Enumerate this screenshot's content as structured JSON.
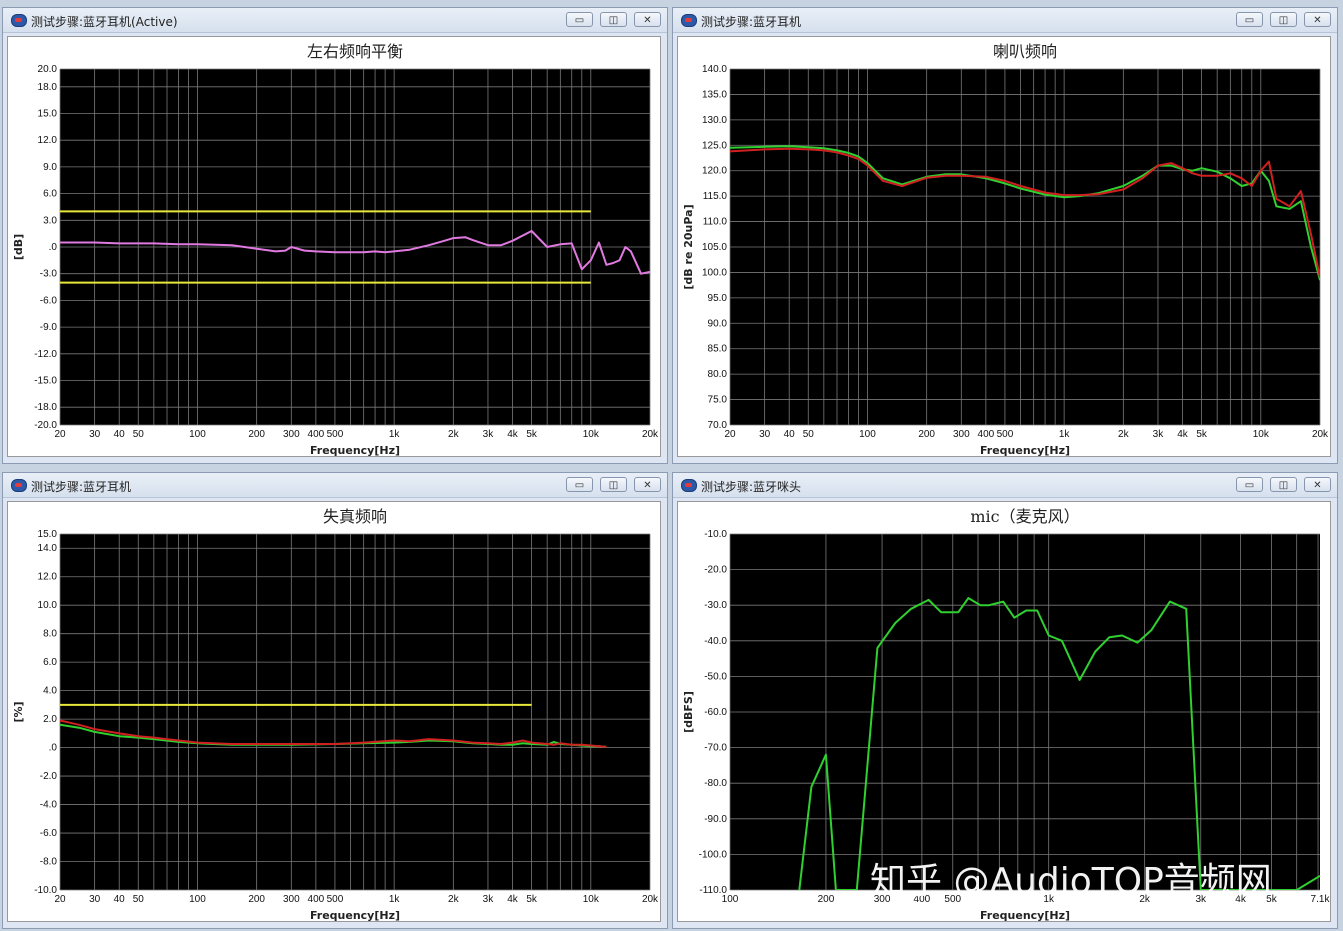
{
  "colors": {
    "plot_bg": "#000000",
    "grid": "#7a7a7a",
    "limit": "#e8e83a",
    "pink": "#e07ae0",
    "green": "#30d030",
    "red": "#d02020"
  },
  "windows": [
    {
      "title": "测试步骤:蓝牙耳机(Active)",
      "buttons": [
        "▭",
        "◫",
        "✕"
      ]
    },
    {
      "title": "测试步骤:蓝牙耳机",
      "buttons": [
        "▭",
        "◫",
        "✕"
      ]
    },
    {
      "title": "测试步骤:蓝牙耳机",
      "buttons": [
        "▭",
        "◫",
        "✕"
      ]
    },
    {
      "title": "测试步骤:蓝牙咪头",
      "buttons": [
        "▭",
        "◫",
        "✕"
      ]
    }
  ],
  "watermark": "知乎 @AudioTOP音频网",
  "chart_data": [
    {
      "type": "line",
      "title": "左右频响平衡",
      "xlabel": "Frequency[Hz]",
      "ylabel": "[dB]",
      "xscale": "log",
      "xlim": [
        20,
        20000
      ],
      "ylim": [
        -20,
        20
      ],
      "yticks": [
        20,
        18,
        15,
        12,
        9,
        6,
        3,
        0,
        -3,
        -6,
        -9,
        -12,
        -15,
        -18,
        -20
      ],
      "ytick_labels": [
        "20.0",
        "18.0",
        "15.0",
        "12.0",
        "9.0",
        "6.0",
        "3.0",
        ".0",
        "-3.0",
        "-6.0",
        "-9.0",
        "-12.0",
        "-15.0",
        "-18.0",
        "-20.0"
      ],
      "xticks": [
        20,
        30,
        40,
        50,
        100,
        200,
        300,
        400,
        500,
        1000,
        2000,
        3000,
        4000,
        5000,
        10000,
        20000
      ],
      "xtick_labels": [
        "20",
        "30",
        "40",
        "50",
        "100",
        "200",
        "300",
        "400",
        "500",
        "1k",
        "2k",
        "3k",
        "4k",
        "5k",
        "10k",
        "20k"
      ],
      "grid": true,
      "series": [
        {
          "color": "#e8e83a",
          "x": [
            20,
            10000
          ],
          "y": [
            4,
            4
          ]
        },
        {
          "color": "#e8e83a",
          "x": [
            20,
            10000
          ],
          "y": [
            -4,
            -4
          ]
        },
        {
          "color": "#e07ae0",
          "x": [
            20,
            30,
            40,
            60,
            80,
            100,
            150,
            200,
            250,
            280,
            300,
            350,
            400,
            500,
            600,
            700,
            800,
            900,
            1000,
            1200,
            1500,
            1800,
            2000,
            2300,
            2500,
            3000,
            3500,
            4000,
            5000,
            6000,
            7000,
            8000,
            9000,
            10000,
            11000,
            12000,
            13000,
            14000,
            15000,
            16000,
            18000,
            20000
          ],
          "y": [
            0.5,
            0.5,
            0.4,
            0.4,
            0.3,
            0.3,
            0.2,
            -0.2,
            -0.5,
            -0.4,
            0.0,
            -0.4,
            -0.5,
            -0.6,
            -0.6,
            -0.6,
            -0.5,
            -0.6,
            -0.5,
            -0.3,
            0.2,
            0.7,
            1.0,
            1.1,
            0.8,
            0.2,
            0.2,
            0.7,
            1.8,
            0.0,
            0.3,
            0.4,
            -2.5,
            -1.5,
            0.5,
            -2.0,
            -1.8,
            -1.5,
            0.0,
            -0.5,
            -3.0,
            -2.8
          ]
        }
      ]
    },
    {
      "type": "line",
      "title": "喇叭频响",
      "xlabel": "Frequency[Hz]",
      "ylabel": "[dB re 20uPa]",
      "xscale": "log",
      "xlim": [
        20,
        20000
      ],
      "ylim": [
        70,
        140
      ],
      "yticks": [
        140,
        135,
        130,
        125,
        120,
        115,
        110,
        105,
        100,
        95,
        90,
        85,
        80,
        75,
        70
      ],
      "ytick_labels": [
        "140.0",
        "135.0",
        "130.0",
        "125.0",
        "120.0",
        "115.0",
        "110.0",
        "105.0",
        "100.0",
        "95.0",
        "90.0",
        "85.0",
        "80.0",
        "75.0",
        "70.0"
      ],
      "xticks": [
        20,
        30,
        40,
        50,
        100,
        200,
        300,
        400,
        500,
        1000,
        2000,
        3000,
        4000,
        5000,
        10000,
        20000
      ],
      "xtick_labels": [
        "20",
        "30",
        "40",
        "50",
        "100",
        "200",
        "300",
        "400",
        "500",
        "1k",
        "2k",
        "3k",
        "4k",
        "5k",
        "10k",
        "20k"
      ],
      "grid": true,
      "series": [
        {
          "name": "",
          "color": "#30d030",
          "x": [
            20,
            30,
            40,
            50,
            60,
            70,
            80,
            90,
            100,
            120,
            150,
            200,
            250,
            300,
            400,
            500,
            600,
            800,
            1000,
            1200,
            1500,
            2000,
            2500,
            3000,
            3500,
            4000,
            4500,
            5000,
            6000,
            7000,
            8000,
            9000,
            10000,
            11000,
            12000,
            14000,
            16000,
            18000,
            20000
          ],
          "y": [
            124.5,
            124.7,
            124.8,
            124.6,
            124.4,
            124.0,
            123.5,
            122.8,
            121.5,
            118.5,
            117.3,
            118.8,
            119.3,
            119.3,
            118.5,
            117.5,
            116.5,
            115.3,
            114.8,
            115.0,
            115.6,
            117.0,
            119.0,
            121.0,
            121.0,
            120.3,
            120.0,
            120.5,
            119.8,
            118.5,
            117.0,
            117.5,
            120.0,
            118.0,
            113.0,
            112.5,
            114.0,
            105.0,
            98.5
          ]
        },
        {
          "name": "",
          "color": "#d02020",
          "x": [
            20,
            30,
            40,
            50,
            60,
            70,
            80,
            90,
            100,
            120,
            150,
            200,
            250,
            300,
            400,
            500,
            600,
            800,
            1000,
            1200,
            1500,
            2000,
            2500,
            3000,
            3500,
            4000,
            4500,
            5000,
            6000,
            7000,
            8000,
            9000,
            10000,
            11000,
            12000,
            14000,
            16000,
            18000,
            20000
          ],
          "y": [
            123.8,
            124.2,
            124.3,
            124.2,
            124.0,
            123.6,
            123.0,
            122.3,
            121.0,
            118.0,
            117.0,
            118.6,
            119.0,
            119.0,
            118.8,
            118.0,
            117.0,
            115.7,
            115.2,
            115.2,
            115.4,
            116.3,
            118.5,
            121.0,
            121.5,
            120.5,
            119.5,
            119.0,
            119.0,
            119.5,
            118.5,
            117.0,
            120.0,
            121.8,
            114.5,
            113.0,
            116.0,
            107.5,
            99.0
          ]
        }
      ]
    },
    {
      "type": "line",
      "title": "失真频响",
      "xlabel": "Frequency[Hz]",
      "ylabel": "[%]",
      "xscale": "log",
      "xlim": [
        20,
        20000
      ],
      "ylim": [
        -10,
        15
      ],
      "yticks": [
        15,
        14,
        12,
        10,
        8,
        6,
        4,
        2,
        0,
        -2,
        -4,
        -6,
        -8,
        -10
      ],
      "ytick_labels": [
        "15.0",
        "14.0",
        "12.0",
        "10.0",
        "8.0",
        "6.0",
        "4.0",
        "2.0",
        ".0",
        "-2.0",
        "-4.0",
        "-6.0",
        "-8.0",
        "-10.0"
      ],
      "xticks": [
        20,
        30,
        40,
        50,
        100,
        200,
        300,
        400,
        500,
        1000,
        2000,
        3000,
        4000,
        5000,
        10000,
        20000
      ],
      "xtick_labels": [
        "20",
        "30",
        "40",
        "50",
        "100",
        "200",
        "300",
        "400",
        "500",
        "1k",
        "2k",
        "3k",
        "4k",
        "5k",
        "10k",
        "20k"
      ],
      "grid": true,
      "series": [
        {
          "color": "#e8e83a",
          "x": [
            20,
            5000
          ],
          "y": [
            3,
            3
          ]
        },
        {
          "name": "",
          "color": "#30d030",
          "x": [
            20,
            25,
            30,
            40,
            50,
            60,
            80,
            100,
            120,
            150,
            200,
            300,
            500,
            700,
            1000,
            1200,
            1500,
            2000,
            2500,
            3000,
            3500,
            4000,
            4500,
            5000,
            6000,
            6500,
            7000,
            8000,
            9000,
            10000,
            11000,
            12000
          ],
          "y": [
            1.6,
            1.4,
            1.1,
            0.8,
            0.7,
            0.6,
            0.4,
            0.3,
            0.25,
            0.2,
            0.2,
            0.2,
            0.25,
            0.3,
            0.35,
            0.4,
            0.5,
            0.45,
            0.3,
            0.25,
            0.2,
            0.2,
            0.3,
            0.25,
            0.2,
            0.4,
            0.25,
            0.2,
            0.15,
            0.1,
            0.1,
            0.05
          ]
        },
        {
          "name": "",
          "color": "#d02020",
          "x": [
            20,
            25,
            30,
            40,
            50,
            60,
            80,
            100,
            120,
            150,
            200,
            300,
            500,
            700,
            1000,
            1200,
            1500,
            2000,
            2500,
            3000,
            3500,
            4000,
            4500,
            5000,
            6000,
            6500,
            7000,
            8000,
            9000,
            10000,
            11000,
            12000
          ],
          "y": [
            1.9,
            1.6,
            1.3,
            1.0,
            0.8,
            0.7,
            0.5,
            0.35,
            0.3,
            0.25,
            0.25,
            0.25,
            0.25,
            0.35,
            0.5,
            0.45,
            0.6,
            0.5,
            0.35,
            0.3,
            0.25,
            0.35,
            0.5,
            0.35,
            0.25,
            0.2,
            0.3,
            0.2,
            0.2,
            0.15,
            0.1,
            0.05
          ]
        }
      ]
    },
    {
      "type": "line",
      "title": "mic（麦克风）",
      "xlabel": "Frequency[Hz]",
      "ylabel": "[dBFS]",
      "xscale": "log",
      "xlim": [
        100,
        7100
      ],
      "ylim": [
        -110,
        -10
      ],
      "yticks": [
        -10,
        -20,
        -30,
        -40,
        -50,
        -60,
        -70,
        -80,
        -90,
        -100,
        -110
      ],
      "ytick_labels": [
        "-10.0",
        "-20.0",
        "-30.0",
        "-40.0",
        "-50.0",
        "-60.0",
        "-70.0",
        "-80.0",
        "-90.0",
        "-100.0",
        "-110.0"
      ],
      "xticks": [
        100,
        200,
        300,
        400,
        500,
        1000,
        2000,
        3000,
        4000,
        5000,
        7100
      ],
      "xtick_labels": [
        "100",
        "200",
        "300",
        "400",
        "500",
        "1k",
        "2k",
        "3k",
        "4k",
        "5k",
        "7.1k"
      ],
      "grid": true,
      "series": [
        {
          "name": "",
          "color": "#30d030",
          "x": [
            165,
            180,
            200,
            215,
            225,
            250,
            290,
            330,
            370,
            420,
            460,
            520,
            560,
            610,
            650,
            720,
            780,
            850,
            920,
            1000,
            1100,
            1250,
            1400,
            1550,
            1700,
            1900,
            2100,
            2400,
            2700,
            3000,
            3300,
            3600,
            4000,
            4400,
            4700,
            5000,
            5500,
            6000,
            7100
          ],
          "y": [
            -110,
            -81,
            -72,
            -110,
            -110,
            -110,
            -42,
            -35,
            -31,
            -28.5,
            -32,
            -32,
            -28,
            -30,
            -30,
            -29,
            -33.5,
            -31.5,
            -31.5,
            -38.5,
            -40,
            -51,
            -43,
            -39,
            -38.5,
            -40.5,
            -37,
            -29,
            -31,
            -110,
            -110,
            -110,
            -110,
            -110,
            -110,
            -110,
            -110,
            -110,
            -106
          ]
        }
      ]
    }
  ]
}
